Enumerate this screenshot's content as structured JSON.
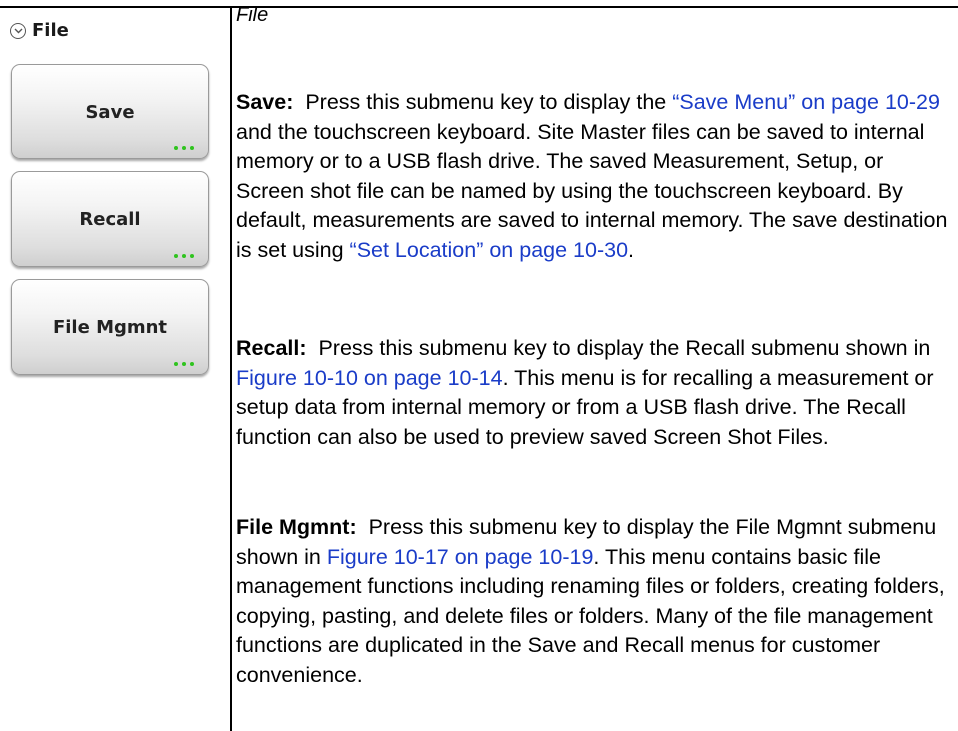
{
  "menu": {
    "title": "File",
    "keys": [
      {
        "label": "Save"
      },
      {
        "label": "Recall"
      },
      {
        "label": "File Mgmnt"
      }
    ]
  },
  "heading": "File",
  "save": {
    "term": "Save:",
    "t1": "Press this submenu key to display the ",
    "link1": "“Save Menu” on page 10-29",
    "t2": " and the touchscreen keyboard. Site Master files can be saved to internal memory or to a USB flash drive. The saved Measurement, Setup, or Screen shot file can be named by using the touchscreen keyboard. By default, measurements are saved to internal memory. The save destination is set using ",
    "link2": "“Set Location” on page 10-30",
    "t3": "."
  },
  "recall": {
    "term": "Recall:",
    "t1": "Press this submenu key to display the Recall submenu shown in ",
    "link1": "Figure 10-10 on page 10-14",
    "t2": ". This menu is for recalling a measurement or setup data from internal memory or from a USB flash drive. The Recall function can also be used to preview saved Screen Shot Files."
  },
  "filemgmnt": {
    "term": "File Mgmnt:",
    "t1": "Press this submenu key to display the File Mgmnt submenu shown in ",
    "link1": "Figure 10-17 on page 10-19",
    "t2": ". This menu contains basic file management functions including renaming files or folders, creating folders, copying, pasting, and delete files or folders. Many of the file management functions are duplicated in the Save and Recall menus for customer convenience."
  }
}
